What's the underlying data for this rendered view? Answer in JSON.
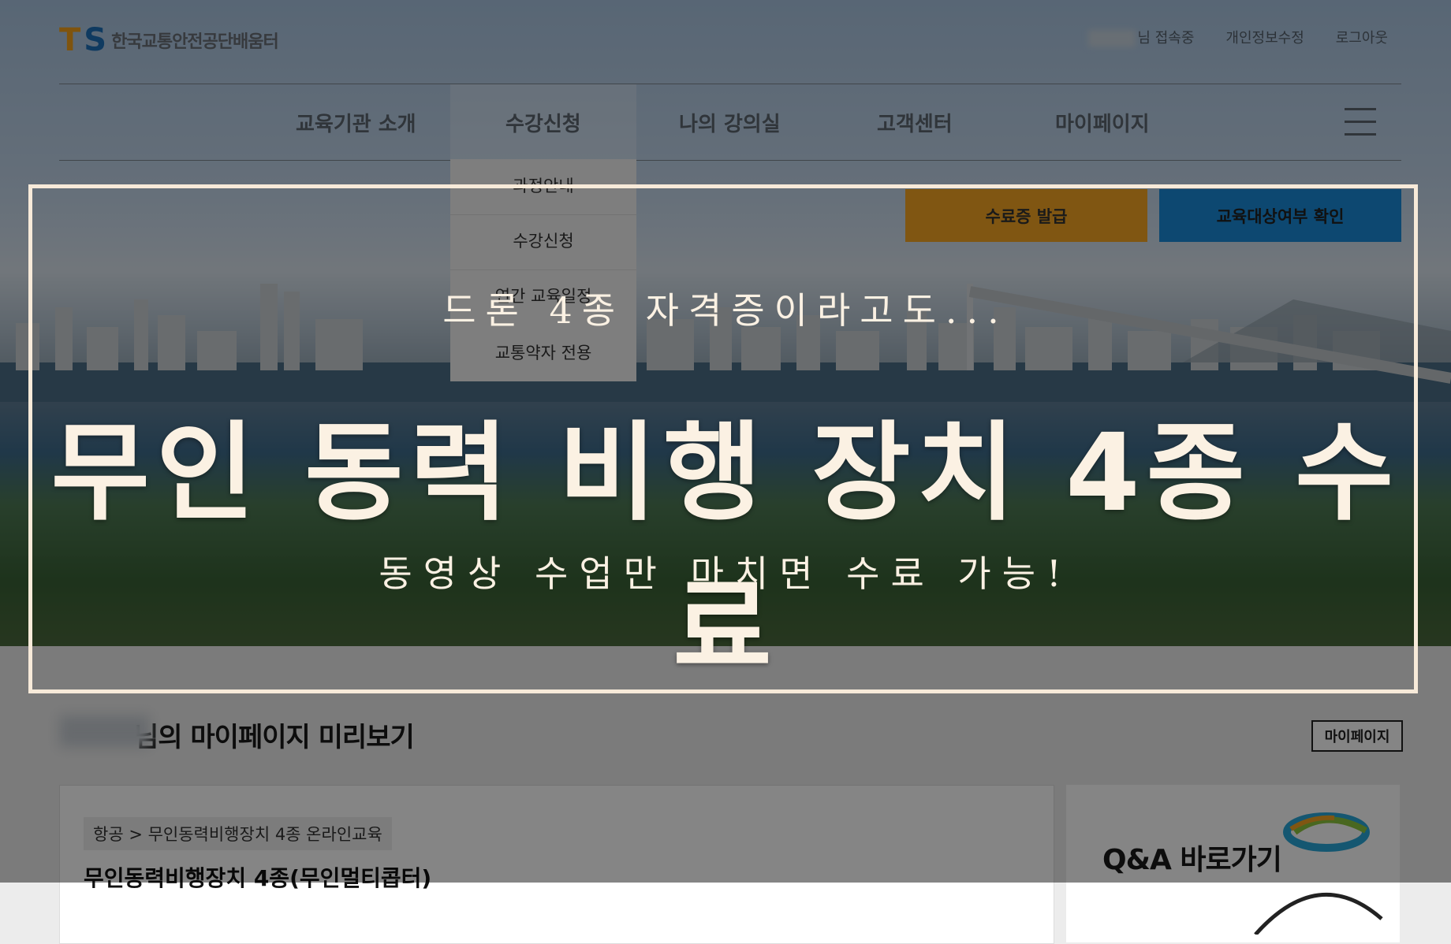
{
  "header": {
    "logo_mark_t": "T",
    "logo_mark_s": "S",
    "logo_text": "한국교통안전공단배움터",
    "util_links": [
      "님 접속중",
      "개인정보수정",
      "로그아웃"
    ]
  },
  "nav": {
    "items": [
      "교육기관 소개",
      "수강신청",
      "나의 강의실",
      "고객센터",
      "마이페이지"
    ],
    "active": "수강신청"
  },
  "dropdown": {
    "items": [
      "과정안내",
      "수강신청",
      "연간 교육일정",
      "교통약자 전용"
    ]
  },
  "buttons": {
    "certificate": "수료증 발급",
    "eligibility": "교육대상여부 확인"
  },
  "mypage": {
    "title_suffix": "님의 마이페이지 미리보기",
    "button": "마이페이지",
    "course_path": "항공 > 무인동력비행장치 4종 온라인교육",
    "course_name": "무인동력비행장치 4종(무인멀티콥터)"
  },
  "qa": {
    "label": "Q&A 바로가기"
  },
  "overlay": {
    "top_line": "드론 4종 자격증이라고도...",
    "main_line": "무인 동력 비행 장치 4종 수료",
    "sub_line": "동영상 수업만 마치면 수료 가능!"
  },
  "colors": {
    "overlay_text": "#fbf1e3",
    "certificate_button": "#f5a623",
    "eligibility_button": "#1a8ad8",
    "logo_orange": "#f3a21c",
    "logo_blue": "#1d6fb8"
  }
}
